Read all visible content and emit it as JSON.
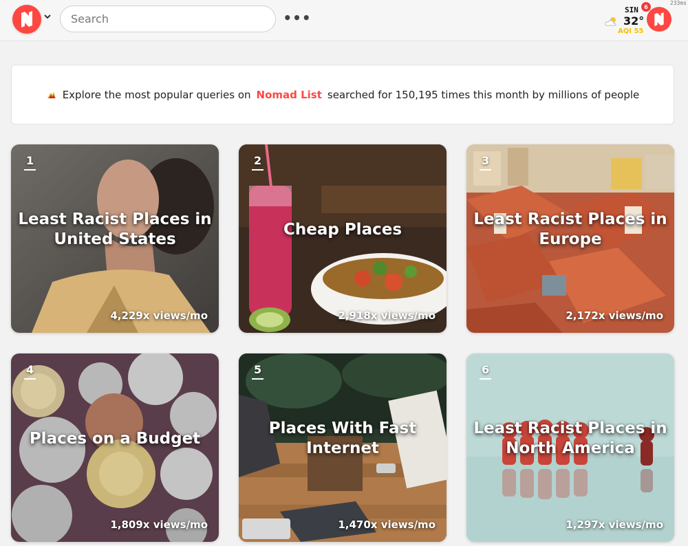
{
  "header": {
    "search_placeholder": "Search",
    "more_label": "•••",
    "latency": "233ms",
    "weather": {
      "city": "SIN",
      "temperature": "32°",
      "aqi": "AQI 55",
      "icon": "partly-cloudy-icon"
    },
    "notification_count": "6",
    "brand_color": "#ff4742"
  },
  "banner": {
    "prefix": "Explore the most popular queries on",
    "brand": "Nomad List",
    "suffix": "searched for 150,195 times this month by millions of people",
    "icon": "fire-icon"
  },
  "cards": [
    {
      "rank": "1",
      "title": "Least Racist Places in United States",
      "views": "4,229x views/mo"
    },
    {
      "rank": "2",
      "title": "Cheap Places",
      "views": "2,918x views/mo"
    },
    {
      "rank": "3",
      "title": "Least Racist Places in Europe",
      "views": "2,172x views/mo"
    },
    {
      "rank": "4",
      "title": "Places on a Budget",
      "views": "1,809x views/mo"
    },
    {
      "rank": "5",
      "title": "Places With Fast Internet",
      "views": "1,470x views/mo"
    },
    {
      "rank": "6",
      "title": "Least Racist Places in North America",
      "views": "1,297x views/mo"
    }
  ]
}
